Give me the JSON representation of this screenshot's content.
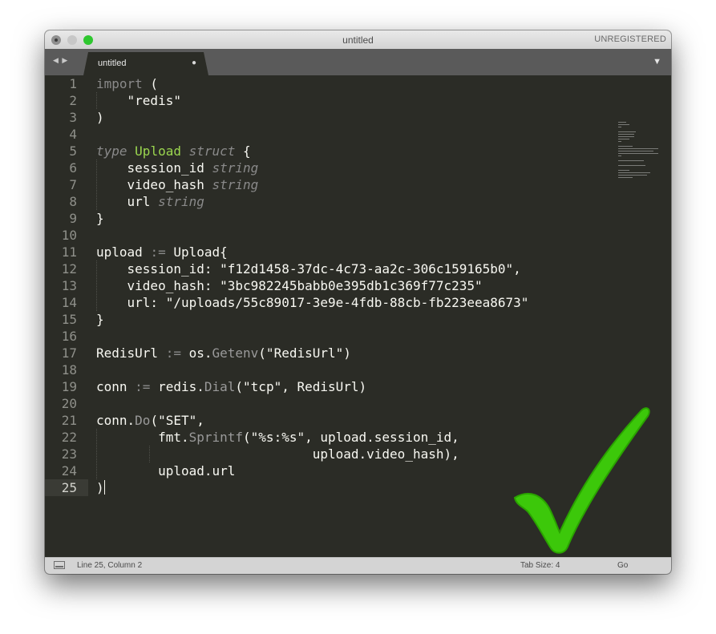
{
  "window": {
    "title": "untitled",
    "registration": "UNREGISTERED"
  },
  "tabs": [
    {
      "label": "untitled",
      "modified_marker": "●"
    }
  ],
  "tabbar": {
    "nav_arrows": "◀ ▶",
    "dropdown": "▼"
  },
  "editor": {
    "line_numbers": [
      "1",
      "2",
      "3",
      "4",
      "5",
      "6",
      "7",
      "8",
      "9",
      "10",
      "11",
      "12",
      "13",
      "14",
      "15",
      "16",
      "17",
      "18",
      "19",
      "20",
      "21",
      "22",
      "23",
      "24",
      "25"
    ],
    "current_line": 25,
    "lines": [
      "import (",
      "    \"redis\"",
      ")",
      "",
      "type Upload struct {",
      "    session_id string",
      "    video_hash string",
      "    url string",
      "}",
      "",
      "upload := Upload{",
      "    session_id: \"f12d1458-37dc-4c73-aa2c-306c159165b0\",",
      "    video_hash: \"3bc982245babb0e395db1c369f77c235\"",
      "    url: \"/uploads/55c89017-3e9e-4fdb-88cb-fb223eea8673\"",
      "}",
      "",
      "RedisUrl := os.Getenv(\"RedisUrl\")",
      "",
      "conn := redis.Dial(\"tcp\", RedisUrl)",
      "",
      "conn.Do(\"SET\",",
      "        fmt.Sprintf(\"%s:%s\", upload.session_id,",
      "                            upload.video_hash),",
      "        upload.url",
      ")"
    ]
  },
  "statusbar": {
    "position": "Line 25, Column 2",
    "tab_size": "Tab Size: 4",
    "syntax": "Go"
  },
  "colors": {
    "editor_bg": "#2b2c26",
    "type_name": "#9bd64f",
    "checkmark": "#3cc80a"
  },
  "icons": [
    "close-button-icon",
    "minimize-button-icon",
    "zoom-button-icon",
    "tab-nav-arrows-icon",
    "tab-modified-dot-icon",
    "tab-dropdown-icon",
    "panel-toggle-icon",
    "checkmark-icon"
  ]
}
